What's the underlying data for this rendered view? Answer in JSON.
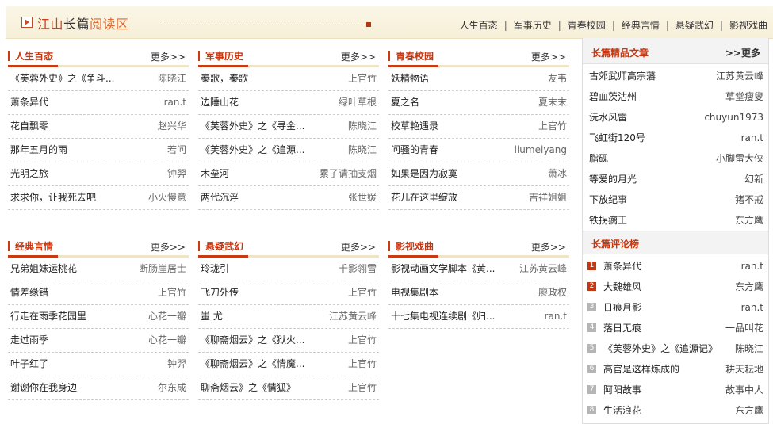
{
  "header": {
    "brand_part1": "江山",
    "brand_part2": "长篇",
    "brand_part3": "阅读区",
    "nav": [
      "人生百态",
      "军事历史",
      "青春校园",
      "经典言情",
      "悬疑武幻",
      "影视戏曲"
    ]
  },
  "more_label": "更多>>",
  "blocks": [
    {
      "title": "人生百态",
      "items": [
        {
          "title": "《芙蓉外史》之《争斗...",
          "author": "陈晓江"
        },
        {
          "title": "萧条异代",
          "author": "ran.t"
        },
        {
          "title": "花自飘零",
          "author": "赵兴华"
        },
        {
          "title": "那年五月的雨",
          "author": "若问"
        },
        {
          "title": "光明之旅",
          "author": "钟羿"
        },
        {
          "title": "求求你，让我死去吧",
          "author": "小火慢意"
        }
      ]
    },
    {
      "title": "军事历史",
      "items": [
        {
          "title": "秦歌，秦歌",
          "author": "上官竹"
        },
        {
          "title": "边陲山花",
          "author": "绿叶草根"
        },
        {
          "title": "《芙蓉外史》之《寻金...",
          "author": "陈晓江"
        },
        {
          "title": "《芙蓉外史》之《追源...",
          "author": "陈晓江"
        },
        {
          "title": "木垒河",
          "author": "累了请抽支烟"
        },
        {
          "title": "两代沉浮",
          "author": "张世媛"
        }
      ]
    },
    {
      "title": "青春校园",
      "items": [
        {
          "title": "妖精物语",
          "author": "友韦"
        },
        {
          "title": "夏之名",
          "author": "夏末末"
        },
        {
          "title": "校草艳遇录",
          "author": "上官竹"
        },
        {
          "title": "问骚的青春",
          "author": "liumeiyang"
        },
        {
          "title": "如果是因为寂寞",
          "author": "萧冰"
        },
        {
          "title": "花儿在这里绽放",
          "author": "吉祥姐姐"
        }
      ]
    },
    {
      "title": "经典言情",
      "items": [
        {
          "title": "兄弟姐妹运桃花",
          "author": "断肠崖居士"
        },
        {
          "title": "情差缘错",
          "author": "上官竹"
        },
        {
          "title": "行走在雨季花园里",
          "author": "心花一瓣"
        },
        {
          "title": "走过雨季",
          "author": "心花一瓣"
        },
        {
          "title": "叶子红了",
          "author": "钟羿"
        },
        {
          "title": "谢谢你在我身边",
          "author": "尔东成"
        }
      ]
    },
    {
      "title": "悬疑武幻",
      "items": [
        {
          "title": "玲珑引",
          "author": "千影翎雪"
        },
        {
          "title": "飞刀外传",
          "author": "上官竹"
        },
        {
          "title": "蚩 尤",
          "author": "江苏黄云峰"
        },
        {
          "title": "《聊斋烟云》之《狱火...",
          "author": "上官竹"
        },
        {
          "title": "《聊斋烟云》之《情魔...",
          "author": "上官竹"
        },
        {
          "title": "聊斋烟云》之《情狐》",
          "author": "上官竹"
        }
      ]
    },
    {
      "title": "影视戏曲",
      "items": [
        {
          "title": "影视动画文学脚本《黄...",
          "author": "江苏黄云峰"
        },
        {
          "title": "电视集剧本",
          "author": "廖政权"
        },
        {
          "title": "十七集电视连续剧《归...",
          "author": "ran.t"
        }
      ]
    }
  ],
  "featured": {
    "title": "长篇精品文章",
    "more": ">>更多",
    "items": [
      {
        "title": "古郊武师高宗藩",
        "author": "江苏黄云峰"
      },
      {
        "title": "碧血茨沽州",
        "author": "草堂瘦叟"
      },
      {
        "title": "沅水风雷",
        "author": "chuyun1973"
      },
      {
        "title": "飞虹街120号",
        "author": "ran.t"
      },
      {
        "title": "脂砚",
        "author": "小脚雷大侠"
      },
      {
        "title": "等爱的月光",
        "author": "幻新"
      },
      {
        "title": "下放纪事",
        "author": "猪不戒"
      },
      {
        "title": "铁拐瘸王",
        "author": "东方鹰"
      }
    ]
  },
  "reviews": {
    "title": "长篇评论榜",
    "items": [
      {
        "rank": "1",
        "title": "萧条异代",
        "author": "ran.t"
      },
      {
        "rank": "2",
        "title": "大魏雄风",
        "author": "东方鹰"
      },
      {
        "rank": "3",
        "title": "日痕月影",
        "author": "ran.t"
      },
      {
        "rank": "4",
        "title": "落日无痕",
        "author": "一品叫花"
      },
      {
        "rank": "5",
        "title": "《芙蓉外史》之《追源记》",
        "author": "陈晓江"
      },
      {
        "rank": "6",
        "title": "高官是这样炼成的",
        "author": "耕天耘地"
      },
      {
        "rank": "7",
        "title": "阿阳故事",
        "author": "故事中人"
      },
      {
        "rank": "8",
        "title": "生活浪花",
        "author": "东方鹰"
      }
    ]
  },
  "colors": {
    "accent": "#c8360f",
    "header_bg": "#f8f2df"
  }
}
